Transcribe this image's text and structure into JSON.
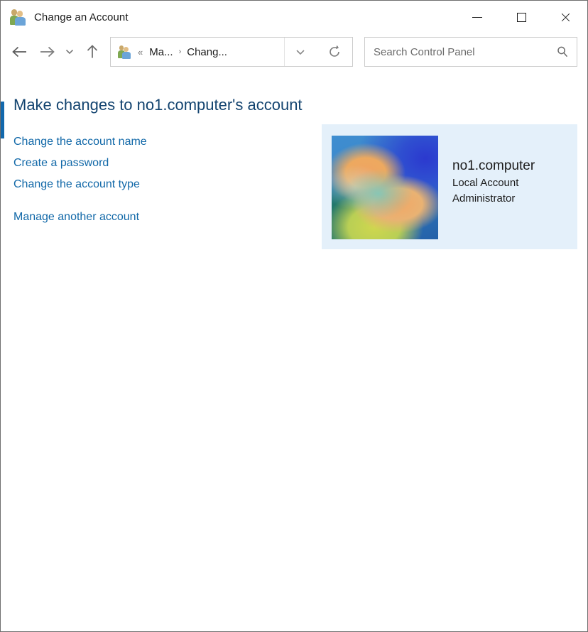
{
  "window": {
    "title": "Change an Account",
    "icon": "user-accounts-icon",
    "controls": {
      "minimize": "Minimize",
      "maximize": "Maximize",
      "close": "Close"
    }
  },
  "navbar": {
    "back": "Back",
    "forward": "Forward",
    "recent": "Recent locations",
    "up": "Up",
    "address": {
      "icon": "user-accounts-icon",
      "leading_chevrons": "«",
      "crumbs": [
        {
          "label": "Ma...",
          "separator": "›"
        },
        {
          "label": "Chang...",
          "separator": ""
        }
      ],
      "dropdown": "chevron-down-icon"
    },
    "refresh": "Refresh",
    "search": {
      "placeholder": "Search Control Panel",
      "value": "",
      "icon": "search-icon"
    }
  },
  "content": {
    "page_title": "Make changes to no1.computer's account",
    "task_links": [
      {
        "label": "Change the account name",
        "spaced": false
      },
      {
        "label": "Create a password",
        "spaced": false
      },
      {
        "label": "Change the account type",
        "spaced": false
      },
      {
        "label": "Manage another account",
        "spaced": true
      }
    ],
    "account": {
      "avatar": "user-avatar-image",
      "name": "no1.computer",
      "type": "Local Account",
      "role": "Administrator"
    }
  },
  "colors": {
    "page_title": "#12436f",
    "link": "#1168a8",
    "panel_background": "#e4f0fa",
    "accent_bar": "#1268ac",
    "window_border": "#6e6e6e"
  }
}
